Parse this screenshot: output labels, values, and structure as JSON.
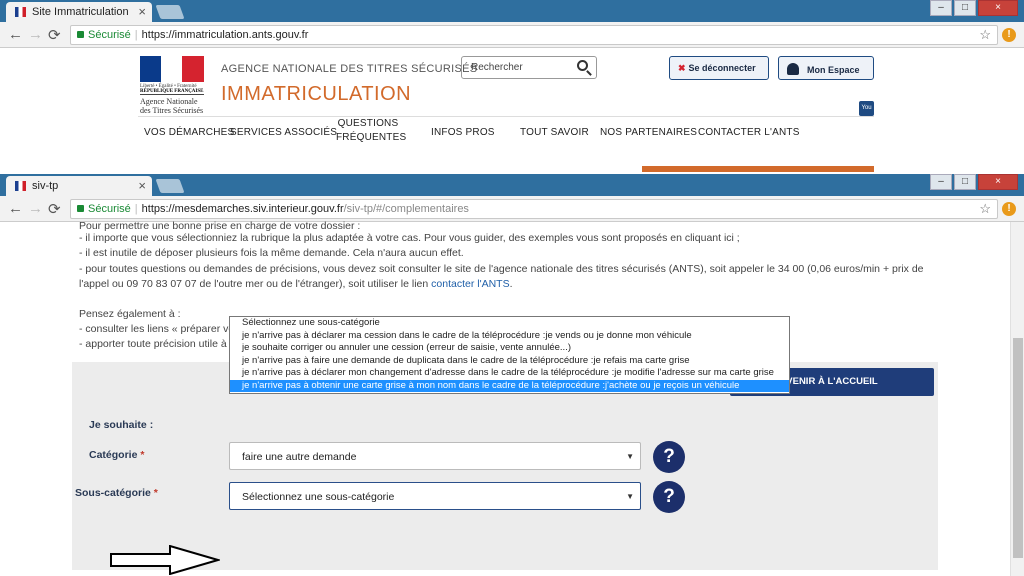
{
  "window1": {
    "tab_title": "Site Immatriculation",
    "secure_label": "Sécurisé",
    "url": "https://immatriculation.ants.gouv.fr",
    "logo": {
      "line1": "Liberté • Égalité • Fraternité",
      "line2": "RÉPUBLIQUE FRANÇAISE",
      "line3": "Agence Nationale des Titres Sécurisés"
    },
    "agency_name": "AGENCE NATIONALE DES TITRES SÉCURISÉS",
    "site_title": "IMMATRICULATION",
    "search_placeholder": "Rechercher",
    "logout_label": "Se déconnecter",
    "account_label": "Mon Espace",
    "youtube_label": "You Tube",
    "menu": [
      "VOS DÉMARCHES",
      "SERVICES ASSOCIÉS",
      "QUESTIONS FRÉQUENTES",
      "INFOS PROS",
      "TOUT SAVOIR",
      "NOS PARTENAIRES",
      "CONTACTER L'ANTS"
    ]
  },
  "window2": {
    "tab_title": "siv-tp",
    "secure_label": "Sécurisé",
    "url_host": "https://mesdemarches.siv.interieur.gouv.fr",
    "url_path": "/siv-tp/#/complementaires",
    "paragraphs": {
      "p0": "Pour permettre une bonne prise en charge de votre dossier :",
      "p1": "- il importe que vous sélectionniez la rubrique la plus adaptée à votre cas. Pour vous guider, des exemples vous sont proposés en cliquant ici ;",
      "p2": "- il est inutile de déposer plusieurs fois la même demande. Cela n'aura aucun effet.",
      "p3": "- pour toutes questions ou demandes de précisions, vous devez soit consulter le site de l'agence nationale des titres sécurisés (ANTS), soit appeler le 34 00 (0,06 euros/min + prix de",
      "p4a": "l'appel ou 09 70 83 07 07 de l'outre mer ou de l'étranger), soit utiliser le lien ",
      "p4link": "contacter l'ANTS",
      "p4b": ".",
      "p5": "Pensez également à :",
      "p6": "- consulter les liens « préparer votre demande » pour connaître les informations utiles et pièces justificatives à joindre ;",
      "p7": "- apporter toute précision utile à l'appui de votre demande dans le champ de saisie libre."
    },
    "form": {
      "heading": "Je souhaite :",
      "categorie_label": "Catégorie",
      "categorie_value": "faire une autre demande",
      "sous_categorie_label": "Sous-catégorie",
      "sous_categorie_value": "Sélectionnez une sous-catégorie",
      "required_mark": "*",
      "help_label": "?"
    },
    "dropdown_options": [
      "Sélectionnez une sous-catégorie",
      "je n'arrive pas à déclarer ma cession dans le cadre de la téléprocédure :je vends ou je donne mon véhicule",
      "je souhaite corriger ou annuler une cession (erreur de saisie, vente annulée...)",
      "je n'arrive pas à faire une demande de duplicata dans le cadre de la téléprocédure :je refais ma carte grise",
      "je n'arrive pas à déclarer mon changement d'adresse dans le cadre de la téléprocédure :je modifie l'adresse sur ma carte grise",
      "je n'arrive pas à obtenir une carte grise à mon nom dans le cadre de la téléprocédure :j'achète ou je reçois un véhicule"
    ],
    "back_button": "VENIR À L'ACCUEIL"
  }
}
